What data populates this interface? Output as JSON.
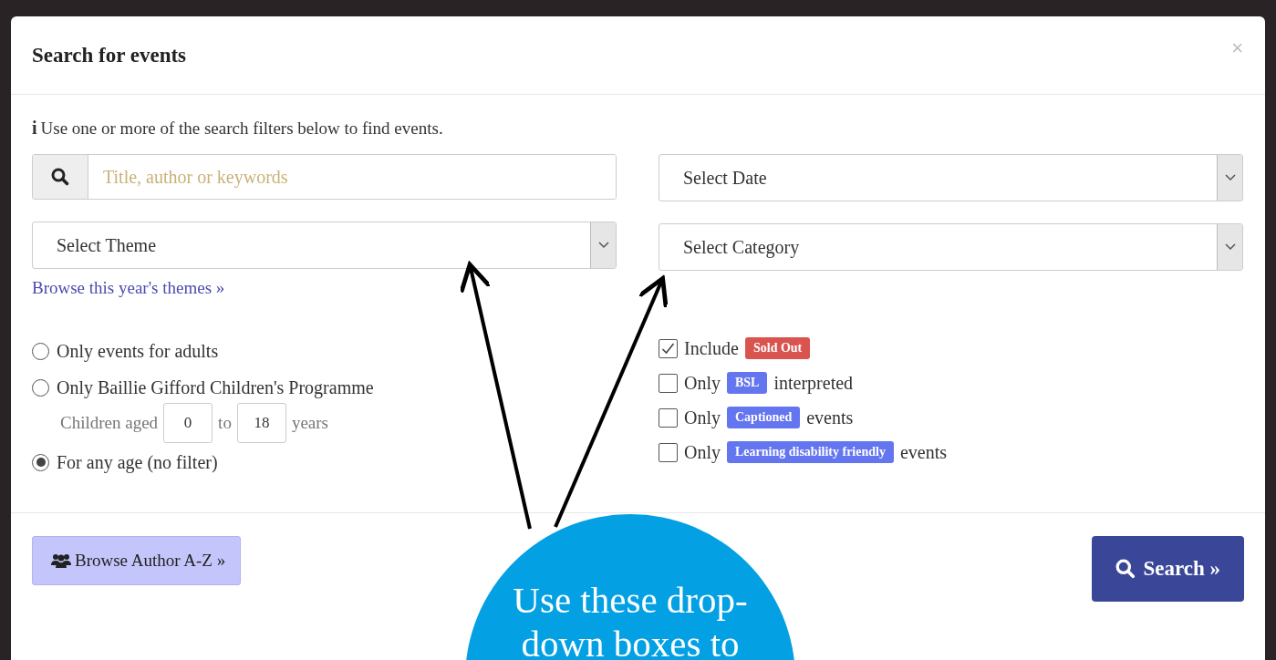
{
  "modal": {
    "title": "Search for events",
    "close": "×"
  },
  "intro": {
    "icon": "i",
    "text": "Use one or more of the search filters below to find events."
  },
  "search": {
    "placeholder": "Title, author or keywords"
  },
  "date_select": {
    "label": "Select Date"
  },
  "theme_select": {
    "label": "Select Theme"
  },
  "category_select": {
    "label": "Select Category"
  },
  "themes_link": "Browse this year's themes »",
  "age_options": [
    {
      "label": "Only events for adults",
      "selected": false
    },
    {
      "label": "Only Baillie Gifford Children's Programme",
      "selected": false,
      "range": {
        "prefix": "Children aged",
        "from": "0",
        "middle": "to",
        "to": "18",
        "suffix": "years"
      }
    },
    {
      "label": "For any age (no filter)",
      "selected": true
    }
  ],
  "filters": [
    {
      "before": "Include",
      "badge": "Sold Out",
      "color": "#d9534f",
      "checked": true
    },
    {
      "before": "Only",
      "badge": "BSL",
      "color": "#6475f0",
      "after": "interpreted",
      "checked": false
    },
    {
      "before": "Only",
      "badge": "Captioned",
      "color": "#6475f0",
      "after": "events",
      "checked": false
    },
    {
      "before": "Only",
      "badge": "Learning disability friendly",
      "color": "#6475f0",
      "after": "events",
      "checked": false
    }
  ],
  "footer": {
    "browse_button": "Browse Author A-Z »",
    "search_button": "Search »"
  },
  "callout": {
    "lines": [
      "Use these drop-",
      "down boxes to"
    ]
  }
}
